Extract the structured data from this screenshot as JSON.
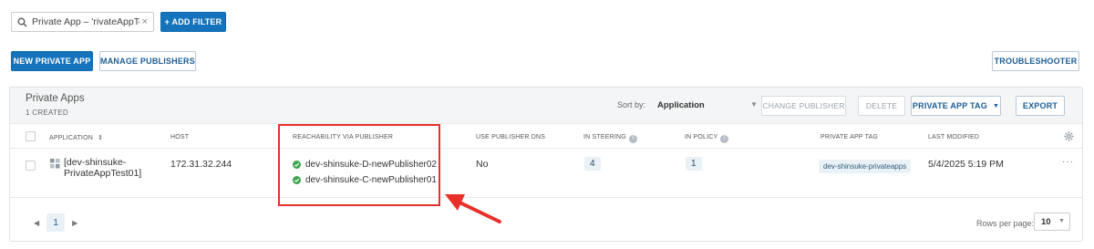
{
  "filter": {
    "text": "Private App – 'rivateAppTest01]",
    "clear": "×"
  },
  "toolbar": {
    "add_filter": "+ ADD FILTER",
    "new_private_app": "NEW PRIVATE APP",
    "manage_publishers": "MANAGE PUBLISHERS",
    "troubleshooter": "TROUBLESHOOTER"
  },
  "panel": {
    "title": "Private Apps",
    "count": "1 CREATED",
    "sort_by_label": "Sort by:",
    "sort_value": "Application",
    "actions": {
      "change_publisher": "CHANGE PUBLISHER",
      "delete": "DELETE",
      "private_app_tag": "PRIVATE APP TAG",
      "export": "EXPORT"
    }
  },
  "table": {
    "columns": [
      "APPLICATION",
      "HOST",
      "REACHABILITY VIA PUBLISHER",
      "USE PUBLISHER DNS",
      "IN STEERING",
      "IN POLICY",
      "PRIVATE APP TAG",
      "LAST MODIFIED"
    ],
    "sort_indicator": "⇕",
    "rows": [
      {
        "application_line1": "[dev-shinsuke-",
        "application_line2": "PrivateAppTest01]",
        "host": "172.31.32.244",
        "publishers": [
          "dev-shinsuke-D-newPublisher02",
          "dev-shinsuke-C-newPublisher01"
        ],
        "use_publisher_dns": "No",
        "in_steering": "4",
        "in_policy": "1",
        "private_app_tag": "dev-shinsuke-privateapps",
        "last_modified": "5/4/2025 5:19 PM",
        "more": "···"
      }
    ]
  },
  "pagination": {
    "current_page": "1",
    "rows_per_page_label": "Rows per page:",
    "rows_per_page": "10"
  },
  "colors": {
    "primary": "#1573bb",
    "highlight": "#e8312b",
    "status_ok": "#3aa64b"
  },
  "icons": [
    "search-icon",
    "close-icon",
    "sort-icon",
    "settings-gear-icon",
    "info-icon",
    "check-circle-icon",
    "app-grid-icon",
    "chevron-down-icon",
    "chevron-left-icon",
    "chevron-right-icon",
    "more-icon"
  ]
}
